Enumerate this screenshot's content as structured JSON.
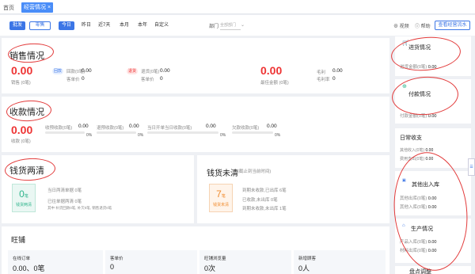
{
  "tabs": {
    "home": "首页",
    "active": "经营情况",
    "close": "×"
  },
  "filter": {
    "seg_all": "批发",
    "seg_retail": "零售",
    "dates": [
      "今日",
      "昨日",
      "近7天",
      "本月",
      "本年",
      "自定义"
    ],
    "dept_label": "部门",
    "dept_placeholder": "全部部门",
    "option1": "⊕ 视频",
    "option2": "ⓘ 帮助",
    "check_btn": "查看经营流水"
  },
  "sales": {
    "title": "销售情况",
    "main_value": "0.00",
    "main_label": "销售 (0笔)",
    "badge1": "回款",
    "v1_label": "回款(0笔)",
    "v1": "0.00",
    "v1b_label": "客单价",
    "v1b": "0",
    "badge2": "退货",
    "v2_label": "退货(0笔)",
    "v2": "0.00",
    "v2b_label": "客单价",
    "v2b": "0",
    "right_value": "0.00",
    "right_label": "最佳金额 (0笔)",
    "profit_label": "毛利",
    "profit": "0.00",
    "margin_label": "毛利率",
    "margin": "0"
  },
  "receipt": {
    "title": "收款情况",
    "main_value": "0.00",
    "main_label": "收款 (0笔)",
    "items": [
      {
        "label": "收预收款(0笔)",
        "value": "0.00",
        "pct": "0%"
      },
      {
        "label": "退预收款(0笔)",
        "value": "0.00",
        "pct": "0%"
      },
      {
        "label": "当日开单当日收款(0笔)",
        "value": "0.00",
        "pct": "0%"
      },
      {
        "label": "欠款收款(0笔)",
        "value": "0.00",
        "pct": "0%"
      }
    ]
  },
  "settled": {
    "title": "钱货两清",
    "box_num": "0",
    "box_unit": "笔",
    "box_label": "钱货两清",
    "line1": "当日两清单据 0笔",
    "line2": "已往单据两清 0笔",
    "line3": "其中 补货回款0笔, 补欠0笔, 销售退货0笔"
  },
  "unsettled": {
    "title": "钱货未清",
    "subtitle": "(截止到当前时间)",
    "box_num": "7",
    "box_unit": "笔",
    "box_label": "钱货未清",
    "line1": "到期未收款,已出库 6笔",
    "line2": "已收款,未出库 0笔",
    "line3": "到期未收款,未出库 1笔"
  },
  "store": {
    "title": "旺铺",
    "cols": [
      {
        "label": "在线订单",
        "value": "0.00、0笔"
      },
      {
        "label": "客单价",
        "value": "0"
      },
      {
        "label": "旺铺浏览量",
        "value": "0次"
      },
      {
        "label": "新增顾客",
        "value": "0人"
      }
    ]
  },
  "right": {
    "purchase": {
      "title": "进货情况",
      "line": "进货金额(0笔)",
      "value": "0.00"
    },
    "payment": {
      "title": "付款情况",
      "line": "付款金额(0笔)",
      "value": "0.00"
    },
    "daily": {
      "title": "日常收支",
      "line1": "其他收入(0笔)",
      "v1": "0.00",
      "line2": "费用支出(0笔)",
      "v2": "0.00"
    },
    "other": {
      "title": "其他出入库",
      "line1": "其他出库(0笔)",
      "v1": "0.00",
      "line2": "其他入库(0笔)",
      "v2": "0.00"
    },
    "production": {
      "title": "生产情况",
      "line1": "产品入库(0笔)",
      "v1": "0.00",
      "line2": "材料出库(0笔)",
      "v2": "0.00"
    },
    "inventory": {
      "title": "盘点调整"
    }
  },
  "scroll_tab": "☰"
}
